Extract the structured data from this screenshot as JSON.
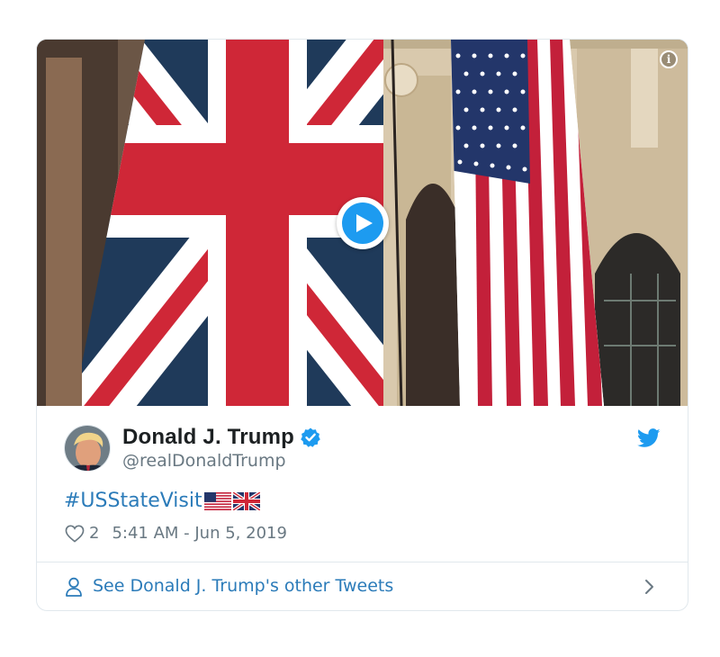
{
  "tweet": {
    "display_name": "Donald J. Trump",
    "handle": "@realDonaldTrump",
    "verified": true,
    "text": "#USStateVisit",
    "flags": [
      "us-flag-icon",
      "uk-flag-icon"
    ],
    "like_count": "2",
    "timestamp": "5:41 AM - Jun 5, 2019"
  },
  "media": {
    "type": "video",
    "info_icon": "info-icon",
    "play_icon": "play-icon"
  },
  "footer": {
    "link_text": "See Donald J. Trump's other Tweets"
  },
  "colors": {
    "link": "#2b7bb9",
    "twitter_blue": "#1d9bf0",
    "muted": "#697882",
    "border": "#e1e8ed"
  }
}
